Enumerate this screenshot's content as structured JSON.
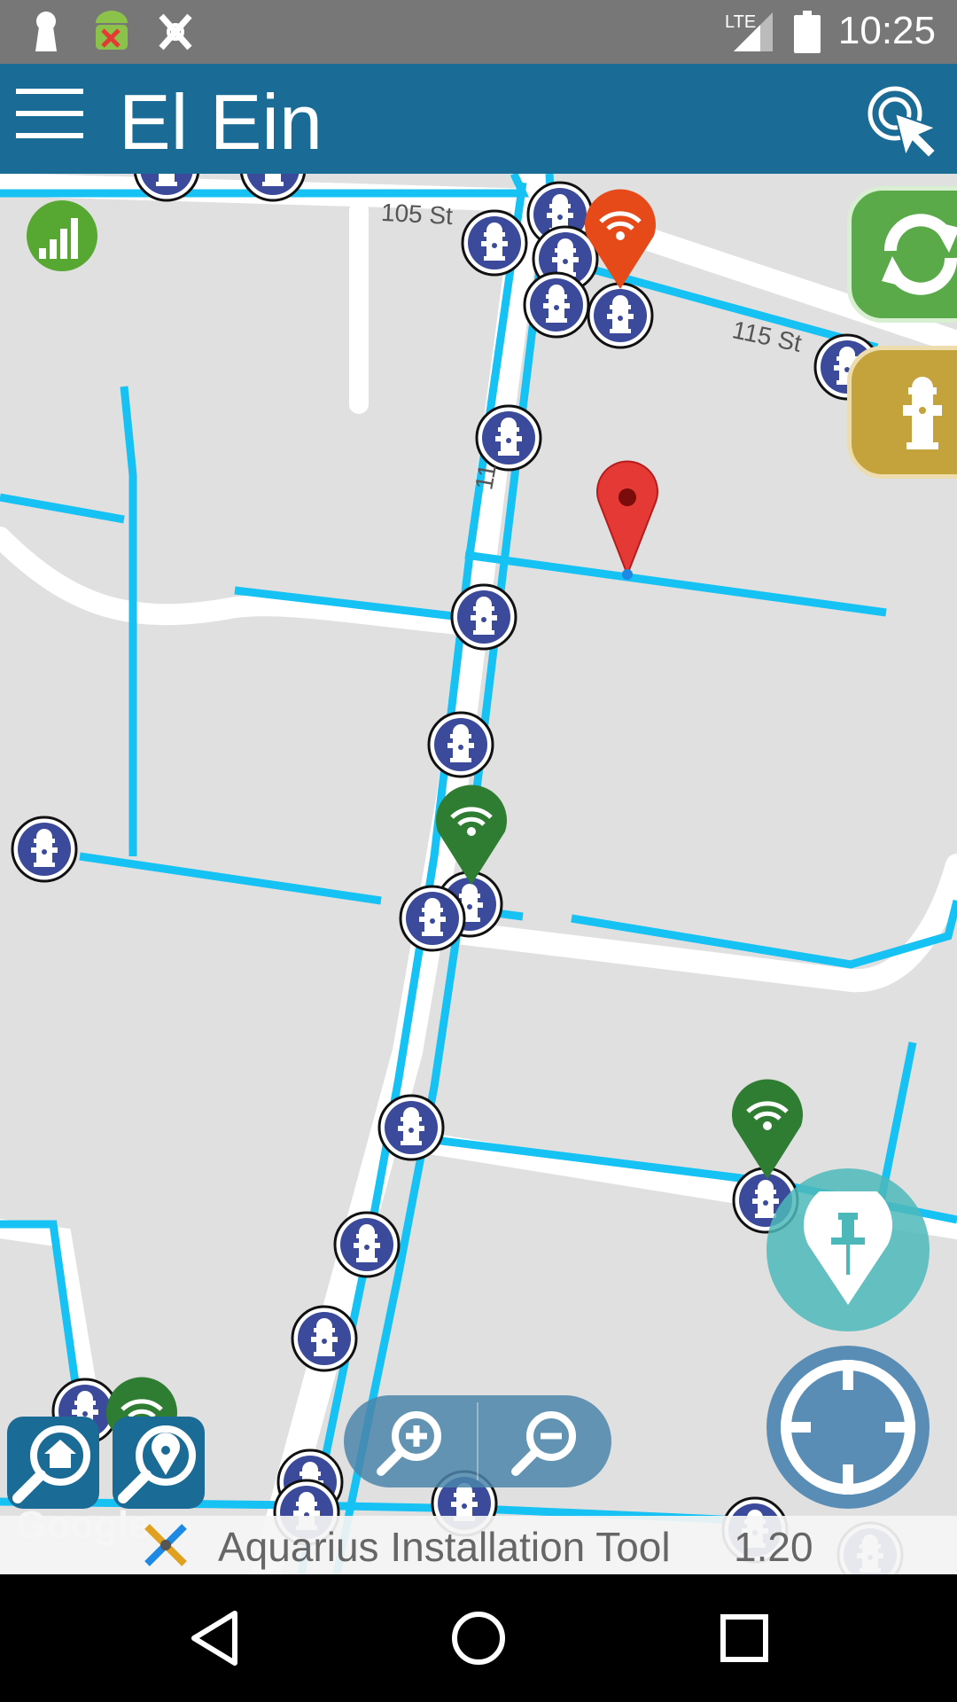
{
  "status_bar": {
    "time": "10:25",
    "network": "LTE",
    "icons": [
      "keyhole-icon",
      "android-debug-icon",
      "tool-icon",
      "signal-icon",
      "battery-icon"
    ]
  },
  "app_bar": {
    "title": "El Ein",
    "icons": [
      "menu-icon",
      "touch-select-icon"
    ]
  },
  "map": {
    "street_labels": [
      "105 St",
      "115 St",
      "11"
    ],
    "attribution": "Google",
    "markers": {
      "hydrant_color": "#3b4a9b",
      "selected_pin_color": "#e53935",
      "wifi_installed_color": "#2e7d32",
      "wifi_pending_color": "#e64a19",
      "pipe_color": "#16c1f3"
    }
  },
  "controls": {
    "refresh_icon": "refresh-icon",
    "hydrant_icon": "hydrant-icon",
    "pin_icon": "pin-icon",
    "locate_icon": "crosshair-icon",
    "zoom_in_icon": "zoom-in-icon",
    "zoom_out_icon": "zoom-out-icon",
    "home_search_icon": "home-search-icon",
    "wifi_search_icon": "wifi-search-icon",
    "signal_strength_icon": "signal-bars-icon"
  },
  "footer": {
    "title": "Aquarius Installation Tool",
    "version": "1.20"
  },
  "nav_bar": {
    "icons": [
      "back-icon",
      "home-icon",
      "recents-icon"
    ]
  }
}
